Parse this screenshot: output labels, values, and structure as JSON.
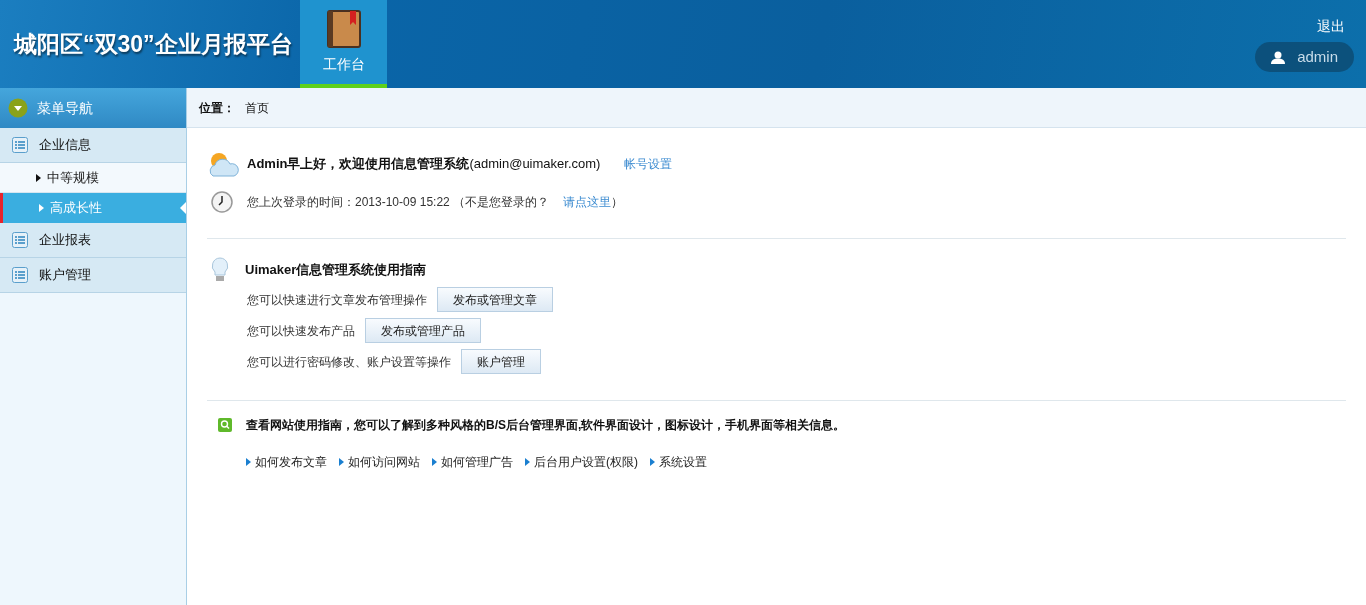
{
  "header": {
    "title": "城阳区“双30”企业月报平台",
    "tabs": [
      {
        "label": "工作台",
        "selected": true
      }
    ],
    "logout": "退出",
    "user": "admin"
  },
  "sidebar": {
    "title": "菜单导航",
    "groups": [
      {
        "label": "企业信息",
        "children": [
          {
            "label": "中等规模",
            "selected": false
          },
          {
            "label": "高成长性",
            "selected": true
          }
        ]
      },
      {
        "label": "企业报表"
      },
      {
        "label": "账户管理"
      }
    ]
  },
  "breadcrumb": {
    "label": "位置：",
    "current": "首页"
  },
  "welcome": {
    "greeting": "**Admin早上好，欢迎使用信息管理系统**(admin@uimaker.com)",
    "link": "帐号设置"
  },
  "last_login": {
    "text": "您上次登录的时间：2013-10-09 15:22 （不是您登录的？",
    "link": "请点这里",
    "suffix": "）"
  },
  "guide": {
    "title": "Uimaker信息管理系统使用指南",
    "rows": [
      {
        "text": "您可以快速进行文章发布管理操作",
        "button": "发布或管理文章"
      },
      {
        "text": "您可以快速发布产品",
        "button": "发布或管理产品"
      },
      {
        "text": "您可以进行密码修改、账户设置等操作",
        "button": "账户管理"
      }
    ]
  },
  "info": {
    "text": "查看网站使用指南，您可以了解到多种风格的B/S后台管理界面,软件界面设计，图标设计，手机界面等相关信息。",
    "links": [
      "如何发布文章",
      "如何访问网站",
      "如何管理广告",
      "后台用户设置(权限)",
      "系统设置"
    ]
  }
}
